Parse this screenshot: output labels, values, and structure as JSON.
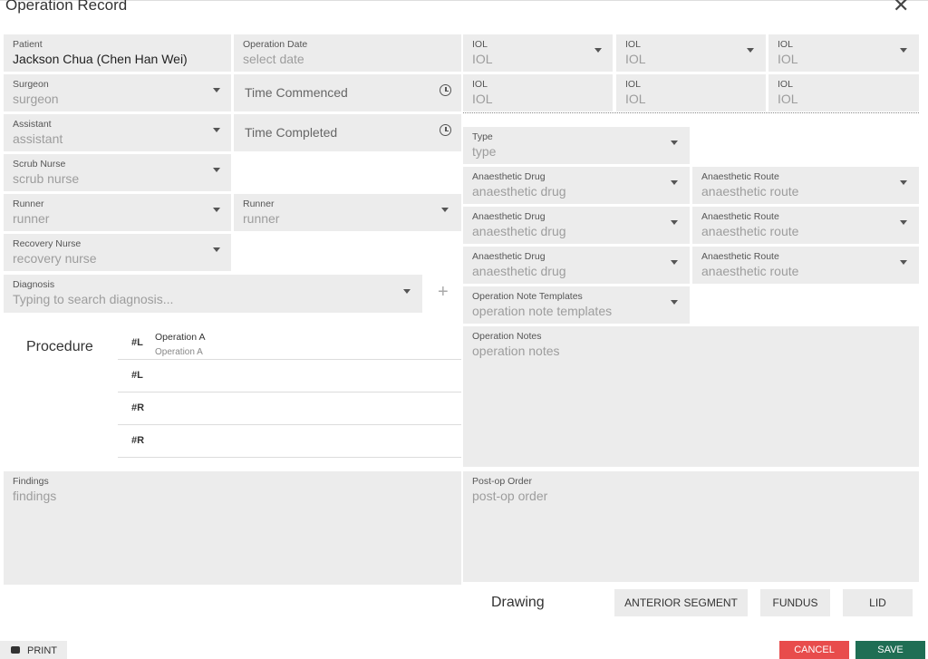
{
  "dialog": {
    "title": "Operation Record",
    "close_icon": "close-icon"
  },
  "patient": {
    "label": "Patient",
    "value": "Jackson Chua (Chen Han Wei)"
  },
  "operation_date": {
    "label": "Operation Date",
    "placeholder": "select date"
  },
  "surgeon": {
    "label": "Surgeon",
    "placeholder": "surgeon"
  },
  "time_commenced": {
    "placeholder": "Time Commenced"
  },
  "assistant": {
    "label": "Assistant",
    "placeholder": "assistant"
  },
  "time_completed": {
    "placeholder": "Time Completed"
  },
  "scrub_nurse": {
    "label": "Scrub Nurse",
    "placeholder": "scrub nurse"
  },
  "runner1": {
    "label": "Runner",
    "placeholder": "runner"
  },
  "runner2": {
    "label": "Runner",
    "placeholder": "runner"
  },
  "recovery_nurse": {
    "label": "Recovery Nurse",
    "placeholder": "recovery nurse"
  },
  "diagnosis": {
    "label": "Diagnosis",
    "placeholder": "Typing to search diagnosis..."
  },
  "iol": [
    {
      "label": "IOL",
      "placeholder": "IOL"
    },
    {
      "label": "IOL",
      "placeholder": "IOL"
    },
    {
      "label": "IOL",
      "placeholder": "IOL"
    },
    {
      "label": "IOL",
      "placeholder": "IOL"
    },
    {
      "label": "IOL",
      "placeholder": "IOL"
    },
    {
      "label": "IOL",
      "placeholder": "IOL"
    }
  ],
  "type": {
    "label": "Type",
    "placeholder": "type"
  },
  "anaesthetic": [
    {
      "drug_label": "Anaesthetic Drug",
      "drug_placeholder": "anaesthetic drug",
      "route_label": "Anaesthetic Route",
      "route_placeholder": "anaesthetic route"
    },
    {
      "drug_label": "Anaesthetic Drug",
      "drug_placeholder": "anaesthetic drug",
      "route_label": "Anaesthetic Route",
      "route_placeholder": "anaesthetic route"
    },
    {
      "drug_label": "Anaesthetic Drug",
      "drug_placeholder": "anaesthetic drug",
      "route_label": "Anaesthetic Route",
      "route_placeholder": "anaesthetic route"
    }
  ],
  "templates": {
    "label": "Operation Note Templates",
    "placeholder": "operation note templates"
  },
  "operation_notes": {
    "label": "Operation Notes",
    "placeholder": "operation notes"
  },
  "procedure": {
    "label": "Procedure",
    "rows": [
      {
        "tag": "#L",
        "name": "Operation A",
        "sub": "Operation A"
      },
      {
        "tag": "#L",
        "name": "",
        "sub": ""
      },
      {
        "tag": "#R",
        "name": "",
        "sub": ""
      },
      {
        "tag": "#R",
        "name": "",
        "sub": ""
      }
    ]
  },
  "findings": {
    "label": "Findings",
    "placeholder": "findings"
  },
  "postop": {
    "label": "Post-op Order",
    "placeholder": "post-op order"
  },
  "drawing": {
    "label": "Drawing",
    "buttons": [
      "ANTERIOR SEGMENT",
      "FUNDUS",
      "LID"
    ]
  },
  "footer": {
    "print": "PRINT",
    "cancel": "CANCEL",
    "save": "SAVE"
  }
}
